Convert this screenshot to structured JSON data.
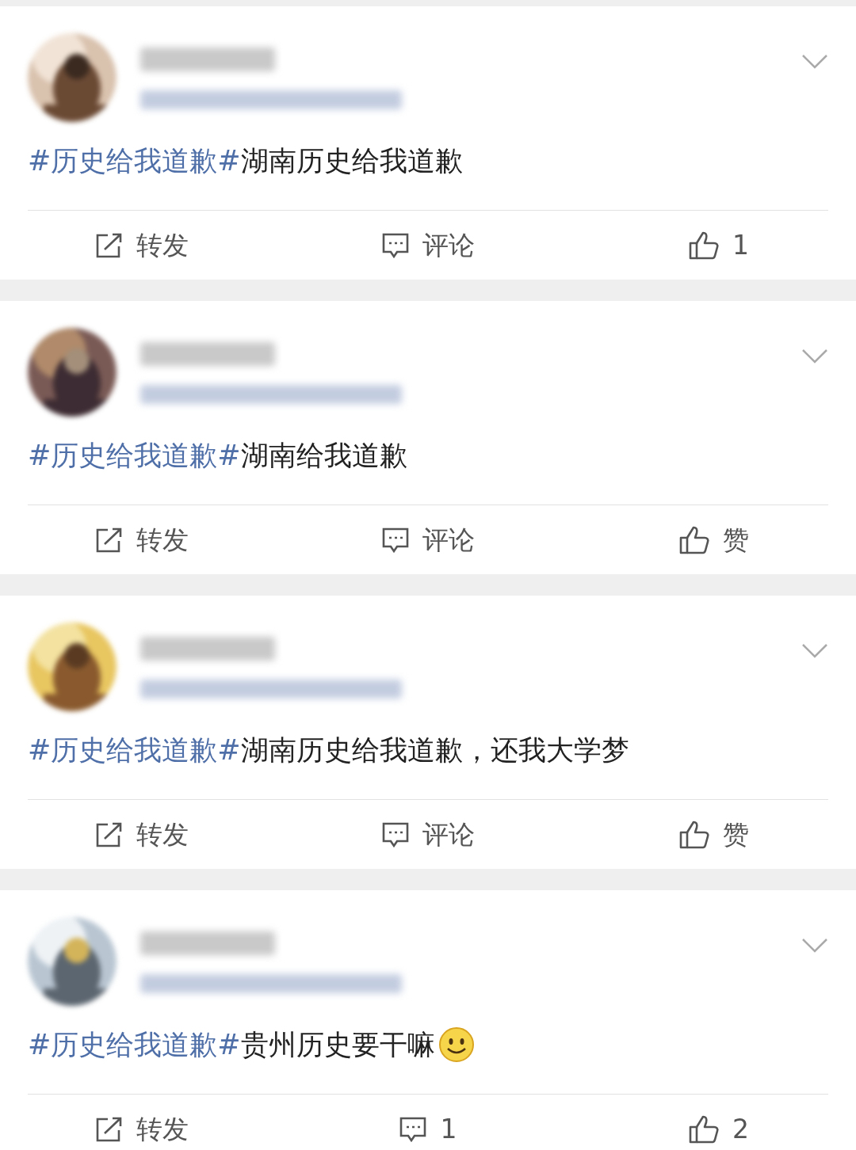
{
  "posts": [
    {
      "hashtag": "#历史给我道歉#",
      "text": "湖南历史给我道歉",
      "emoji": false,
      "actions": [
        {
          "kind": "repost",
          "label": "转发"
        },
        {
          "kind": "comment",
          "label": "评论"
        },
        {
          "kind": "like",
          "label": "1"
        }
      ]
    },
    {
      "hashtag": "#历史给我道歉#",
      "text": "湖南给我道歉",
      "emoji": false,
      "actions": [
        {
          "kind": "repost",
          "label": "转发"
        },
        {
          "kind": "comment",
          "label": "评论"
        },
        {
          "kind": "like",
          "label": "赞"
        }
      ]
    },
    {
      "hashtag": "#历史给我道歉#",
      "text": "湖南历史给我道歉，还我大学梦",
      "emoji": false,
      "actions": [
        {
          "kind": "repost",
          "label": "转发"
        },
        {
          "kind": "comment",
          "label": "评论"
        },
        {
          "kind": "like",
          "label": "赞"
        }
      ]
    },
    {
      "hashtag": "#历史给我道歉#",
      "text": "贵州历史要干嘛",
      "emoji": true,
      "actions": [
        {
          "kind": "repost",
          "label": "转发"
        },
        {
          "kind": "comment",
          "label": "1"
        },
        {
          "kind": "like",
          "label": "2"
        }
      ]
    }
  ]
}
